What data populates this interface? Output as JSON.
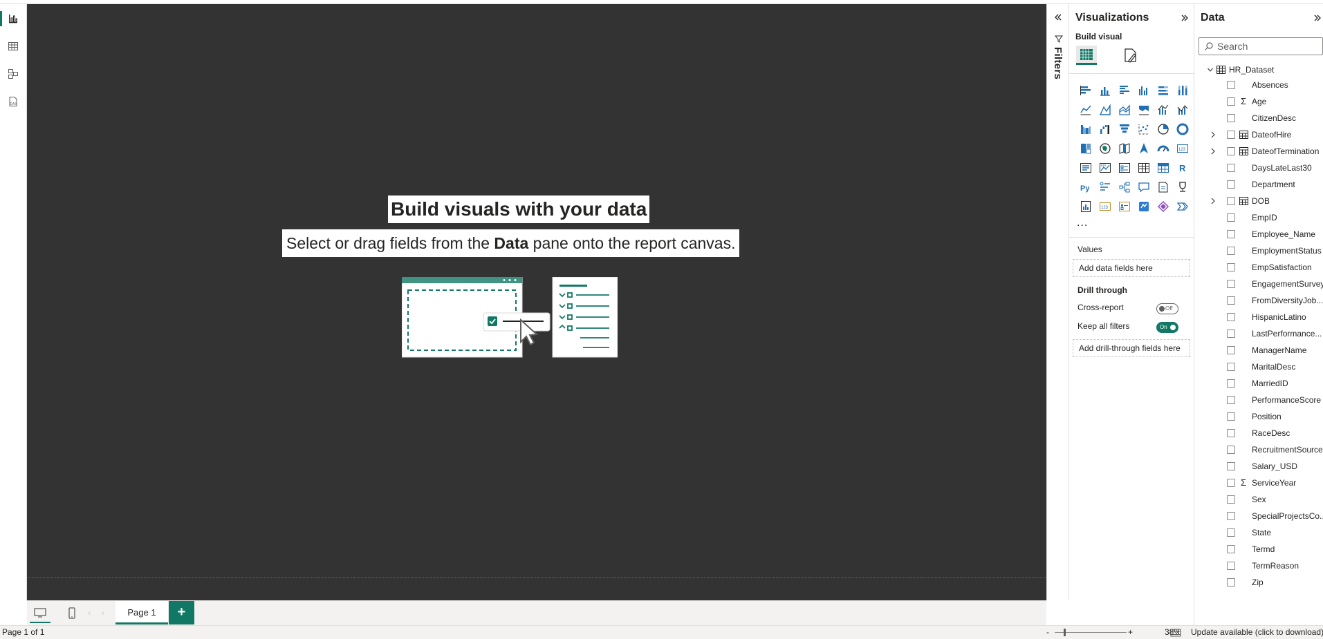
{
  "canvas": {
    "empty_title": "Build visuals with your data",
    "empty_sub_before": "Select or drag fields from the ",
    "empty_sub_bold": "Data",
    "empty_sub_after": " pane onto the report canvas."
  },
  "left_rail": {
    "items": [
      {
        "name": "report-view",
        "icon": "bar-chart-icon",
        "active": true
      },
      {
        "name": "table-view",
        "icon": "table-grid-icon",
        "active": false
      },
      {
        "name": "model-view",
        "icon": "model-diagram-icon",
        "active": false
      },
      {
        "name": "dax-query-view",
        "icon": "dax-icon",
        "active": false
      }
    ]
  },
  "pages": {
    "tabs": [
      {
        "label": "Page 1",
        "active": true
      }
    ],
    "add_label": "+"
  },
  "status_bar": {
    "page_indicator": "Page 1 of 1",
    "zoom_minus": "-",
    "zoom_plus": "+",
    "zoom_value": "38%",
    "update_text": "Update available (click to download)"
  },
  "filters": {
    "label": "Filters"
  },
  "visualizations": {
    "title": "Visualizations",
    "build_visual_label": "Build visual",
    "more_label": "...",
    "values_label": "Values",
    "values_placeholder": "Add data fields here",
    "drill_through_label": "Drill through",
    "cross_report_label": "Cross-report",
    "cross_report_state": "Off",
    "keep_filters_label": "Keep all filters",
    "keep_filters_state": "On",
    "drill_placeholder": "Add drill-through fields here",
    "visual_icons": [
      "stacked-bar-icon",
      "stacked-column-icon",
      "clustered-bar-icon",
      "clustered-column-icon",
      "100-stacked-bar-icon",
      "100-stacked-column-icon",
      "line-chart-icon",
      "area-chart-icon",
      "stacked-area-icon",
      "100-stacked-area-icon",
      "line-clustered-column-icon",
      "line-stacked-column-icon",
      "ribbon-chart-icon",
      "waterfall-chart-icon",
      "funnel-chart-icon",
      "scatter-chart-icon",
      "pie-chart-icon",
      "donut-chart-icon",
      "treemap-icon",
      "map-icon",
      "filled-map-icon",
      "azure-map-icon",
      "gauge-icon",
      "card-icon",
      "multi-row-card-icon",
      "kpi-icon",
      "slicer-icon",
      "table-icon",
      "matrix-icon",
      "r-script-icon",
      "python-icon",
      "key-influencers-icon",
      "decomposition-tree-icon",
      "qa-icon",
      "smart-narrative-icon",
      "metrics-trophy-icon",
      "paginated-report-icon",
      "new-card-icon",
      "new-slicer-icon",
      "power-automate-icon",
      "power-apps-icon",
      "more-visuals-icon"
    ]
  },
  "data_pane": {
    "title": "Data",
    "search_placeholder": "Search",
    "dataset_name": "HR_Dataset",
    "fields": [
      {
        "label": "Absences",
        "icon": "",
        "expandable": false
      },
      {
        "label": "Age",
        "icon": "Σ",
        "expandable": false
      },
      {
        "label": "CitizenDesc",
        "icon": "",
        "expandable": false
      },
      {
        "label": "DateofHire",
        "icon": "calendar",
        "expandable": true
      },
      {
        "label": "DateofTermination",
        "icon": "calendar",
        "expandable": true
      },
      {
        "label": "DaysLateLast30",
        "icon": "",
        "expandable": false
      },
      {
        "label": "Department",
        "icon": "",
        "expandable": false
      },
      {
        "label": "DOB",
        "icon": "calendar",
        "expandable": true
      },
      {
        "label": "EmpID",
        "icon": "",
        "expandable": false
      },
      {
        "label": "Employee_Name",
        "icon": "",
        "expandable": false
      },
      {
        "label": "EmploymentStatus",
        "icon": "",
        "expandable": false
      },
      {
        "label": "EmpSatisfaction",
        "icon": "",
        "expandable": false
      },
      {
        "label": "EngagementSurvey",
        "icon": "",
        "expandable": false
      },
      {
        "label": "FromDiversityJob...",
        "icon": "",
        "expandable": false
      },
      {
        "label": "HispanicLatino",
        "icon": "",
        "expandable": false
      },
      {
        "label": "LastPerformance...",
        "icon": "",
        "expandable": false
      },
      {
        "label": "ManagerName",
        "icon": "",
        "expandable": false
      },
      {
        "label": "MaritalDesc",
        "icon": "",
        "expandable": false
      },
      {
        "label": "MarriedID",
        "icon": "",
        "expandable": false
      },
      {
        "label": "PerformanceScore",
        "icon": "",
        "expandable": false
      },
      {
        "label": "Position",
        "icon": "",
        "expandable": false
      },
      {
        "label": "RaceDesc",
        "icon": "",
        "expandable": false
      },
      {
        "label": "RecruitmentSource",
        "icon": "",
        "expandable": false
      },
      {
        "label": "Salary_USD",
        "icon": "",
        "expandable": false
      },
      {
        "label": "ServiceYear",
        "icon": "Σ",
        "expandable": false
      },
      {
        "label": "Sex",
        "icon": "",
        "expandable": false
      },
      {
        "label": "SpecialProjectsCo...",
        "icon": "",
        "expandable": false
      },
      {
        "label": "State",
        "icon": "",
        "expandable": false
      },
      {
        "label": "Termd",
        "icon": "",
        "expandable": false
      },
      {
        "label": "TermReason",
        "icon": "",
        "expandable": false
      },
      {
        "label": "Zip",
        "icon": "",
        "expandable": false
      }
    ]
  },
  "colors": {
    "accent": "#117865",
    "canvas": "#333333",
    "icon_blue": "#1f6fb5"
  }
}
